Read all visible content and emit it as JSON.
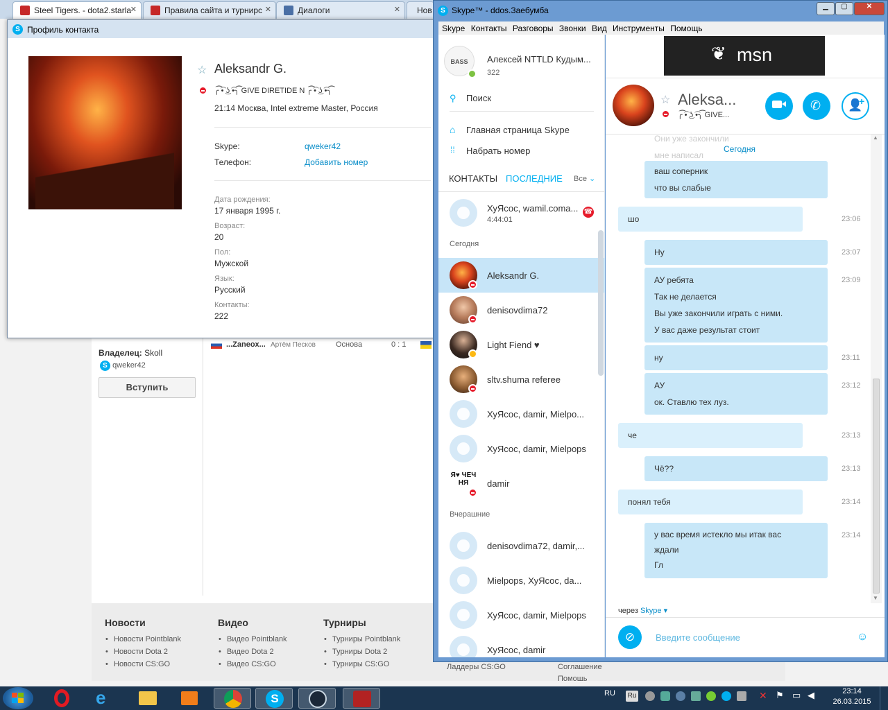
{
  "browser": {
    "tabs": [
      {
        "title": "Steel Tigers. - dota2.starla",
        "active": true
      },
      {
        "title": "Правила сайта и турнирс",
        "active": false
      },
      {
        "title": "Диалоги",
        "active": false
      },
      {
        "title": "Нов",
        "active": false
      }
    ],
    "page": {
      "owner_label": "Владелец:",
      "owner_name": "Skoll",
      "owner_skype": "qweker42",
      "join_button": "Вступить",
      "match_row": {
        "team": "...Zaneox...",
        "player": "Артём Песков",
        "role": "Основа",
        "score": "0 : 1"
      },
      "footer": [
        {
          "title": "Новости",
          "items": [
            "Новости Pointblank",
            "Новости Dota 2",
            "Новости CS:GO"
          ]
        },
        {
          "title": "Видео",
          "items": [
            "Видео Pointblank",
            "Видео Dota 2",
            "Видео CS:GO"
          ]
        },
        {
          "title": "Турниры",
          "items": [
            "Турниры Pointblank",
            "Турниры Dota 2",
            "Турниры CS:GO"
          ]
        }
      ],
      "footer_extra": [
        "Ладдеры CS:GO",
        "Соглашение",
        "Помощь"
      ]
    }
  },
  "profile": {
    "window_title": "Профиль контакта",
    "name": "Aleksandr G.",
    "mood": "╭͡ ͡• ͜ʖ ͡•╮͡ GIVE DIRETIDE N ╭͡ ͡• ͜ʖ ͡•╮͡",
    "location": "21:14 Москва, Intel extreme Master, Россия",
    "skype_label": "Skype:",
    "skype_value": "qweker42",
    "phone_label": "Телефон:",
    "phone_value": "Добавить номер",
    "birthday_label": "Дата рождения:",
    "birthday_value": "17 января 1995 г.",
    "age_label": "Возраст:",
    "age_value": "20",
    "gender_label": "Пол:",
    "gender_value": "Мужской",
    "language_label": "Язык:",
    "language_value": "Русский",
    "contacts_label": "Контакты:",
    "contacts_value": "222"
  },
  "skype": {
    "window_title": "Skype™ - ddos.Заебумба",
    "menu": [
      "Skype",
      "Контакты",
      "Разговоры",
      "Звонки",
      "Вид",
      "Инструменты",
      "Помощь"
    ],
    "me": {
      "name": "Алексей NTTLD Кудым...",
      "credit": "322",
      "badge": "BASS"
    },
    "search": "Поиск",
    "home": "Главная страница Skype",
    "dial": "Набрать номер",
    "tab_contacts": "КОНТАКТЫ",
    "tab_recent": "ПОСЛЕДНИЕ",
    "filter": "Все",
    "pinned": {
      "name": "ХуЯсос, wamil.coma...",
      "duration": "4:44:01"
    },
    "today_label": "Сегодня",
    "yesterday_label": "Вчерашние",
    "contacts_today": [
      {
        "name": "Aleksandr G.",
        "avatar": "volcano",
        "status": "dnd"
      },
      {
        "name": "denisovdima72",
        "avatar": "person",
        "status": "dnd"
      },
      {
        "name": "Light Fiend ♥",
        "avatar": "person",
        "status": "away"
      },
      {
        "name": "sltv.shuma referee",
        "avatar": "person",
        "status": "dnd"
      },
      {
        "name": "ХуЯсос, damir, Mielpo...",
        "avatar": "group",
        "status": ""
      },
      {
        "name": "ХуЯсос, damir, Mielpops",
        "avatar": "group",
        "status": ""
      },
      {
        "name": "damir",
        "avatar": "text",
        "status": "dnd"
      }
    ],
    "contacts_yesterday": [
      {
        "name": "denisovdima72, damir,...",
        "avatar": "group"
      },
      {
        "name": "Mielpops, ХуЯсос, da...",
        "avatar": "group"
      },
      {
        "name": "ХуЯсос, damir, Mielpops",
        "avatar": "group"
      },
      {
        "name": "ХуЯсос, damir",
        "avatar": "group"
      }
    ],
    "damir_avatar_text": "Я♥ ЧЕЧ НЯ",
    "ad_text": "msn",
    "chat": {
      "name": "Aleksa...",
      "mood": "╭͡ ͡• ͜ʖ ͡•╮͡ GIVE...",
      "date_divider": "Сегодня",
      "faded_lines": [
        "Они уже закончили",
        "мне написал"
      ],
      "messages": [
        {
          "dir": "in",
          "lines": [
            "ваш соперник",
            "что вы слабые"
          ],
          "time": ""
        },
        {
          "dir": "out",
          "lines": [
            "шо"
          ],
          "time": "23:06"
        },
        {
          "dir": "in",
          "lines": [
            "Ну"
          ],
          "time": "23:07"
        },
        {
          "dir": "in",
          "lines": [
            "АУ ребята",
            "Так не делается",
            "Вы уже закончили играть с ними.",
            "У вас даже результат стоит"
          ],
          "time": "23:09"
        },
        {
          "dir": "in",
          "lines": [
            "ну"
          ],
          "time": "23:11"
        },
        {
          "dir": "in",
          "lines": [
            "АУ",
            "ок. Ставлю тех луз."
          ],
          "time": "23:12"
        },
        {
          "dir": "out",
          "lines": [
            "че"
          ],
          "time": "23:13"
        },
        {
          "dir": "in",
          "lines": [
            "Чё??"
          ],
          "time": "23:13"
        },
        {
          "dir": "out",
          "lines": [
            "понял тебя"
          ],
          "time": "23:14"
        },
        {
          "dir": "in",
          "lines": [
            "у вас время истекло мы итак вас",
            "ждали",
            "Гл"
          ],
          "time": "23:14"
        }
      ],
      "via_label": "через",
      "via_value": "Skype",
      "input_placeholder": "Введите сообщение"
    }
  },
  "taskbar": {
    "lang": "RU",
    "lang_small": "Ru",
    "time": "23:14",
    "date": "26.03.2015"
  },
  "colors": {
    "skype_blue": "#00aff0",
    "dnd_red": "#e61b2a",
    "bubble": "#c8e7f8",
    "link": "#0a8ec9"
  }
}
